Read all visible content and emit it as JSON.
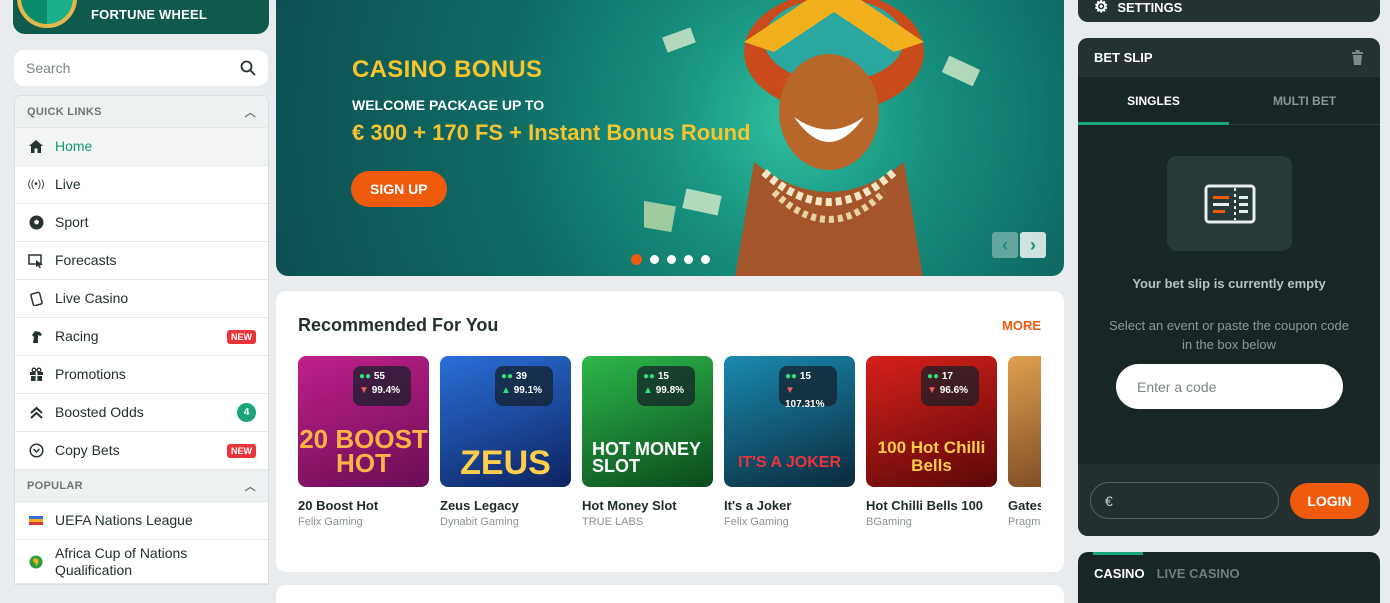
{
  "fortune": {
    "label": "FORTUNE WHEEL"
  },
  "search": {
    "placeholder": "Search"
  },
  "quick_links": {
    "header": "QUICK LINKS",
    "items": [
      {
        "label": "Home",
        "icon": "home-icon"
      },
      {
        "label": "Live",
        "icon": "live-icon"
      },
      {
        "label": "Sport",
        "icon": "soccer-ball-icon"
      },
      {
        "label": "Forecasts",
        "icon": "forecast-icon"
      },
      {
        "label": "Live Casino",
        "icon": "cards-icon"
      },
      {
        "label": "Racing",
        "icon": "horse-icon",
        "badge": "NEW"
      },
      {
        "label": "Promotions",
        "icon": "gift-icon"
      },
      {
        "label": "Boosted Odds",
        "icon": "boost-icon",
        "count": "4"
      },
      {
        "label": "Copy Bets",
        "icon": "copy-bets-icon",
        "badge": "NEW"
      }
    ]
  },
  "popular": {
    "header": "POPULAR",
    "items": [
      {
        "label": "UEFA Nations League"
      },
      {
        "label": "Africa Cup of Nations Qualification"
      }
    ]
  },
  "banner": {
    "title": "CASINO BONUS",
    "subtitle": "WELCOME PACKAGE UP TO",
    "offer": "€ 300 + 170 FS + Instant Bonus Round",
    "cta": "SIGN UP",
    "active_slide": 1,
    "slides": 5
  },
  "recommended": {
    "title": "Recommended For You",
    "more": "MORE",
    "games": [
      {
        "name": "20 Boost Hot",
        "provider": "Felix Gaming",
        "players": "55",
        "rtp": "99.4%",
        "art": "20 BOOST HOT",
        "bg": "#8a1a6a"
      },
      {
        "name": "Zeus Legacy",
        "provider": "Dynabit Gaming",
        "players": "39",
        "rtp": "99.1%",
        "art": "ZEUS",
        "bg": "#1a3f8a"
      },
      {
        "name": "Hot Money Slot",
        "provider": "TRUE LABS",
        "players": "15",
        "rtp": "99.8%",
        "art": "HOT MONEY SLOT",
        "bg": "#1a7a2e"
      },
      {
        "name": "It's a Joker",
        "provider": "Felix Gaming",
        "players": "15",
        "rtp": "107.31%",
        "art": "IT'S A JOKER",
        "bg": "#0f4a6a"
      },
      {
        "name": "Hot Chilli Bells 100",
        "provider": "BGaming",
        "players": "17",
        "rtp": "96.6%",
        "art": "100 Hot Chilli Bells",
        "bg": "#a3151a"
      },
      {
        "name": "Gates of Olympus Super",
        "provider": "Pragmatic Play",
        "players": "",
        "rtp": "",
        "art": "",
        "bg": "#8a5a2a"
      }
    ]
  },
  "settings": {
    "label": "SETTINGS"
  },
  "betslip": {
    "title": "BET SLIP",
    "tabs": [
      "SINGLES",
      "MULTI BET"
    ],
    "empty_title": "Your bet slip is currently empty",
    "empty_sub": "Select an event or paste the coupon code in the box below",
    "code_placeholder": "Enter a code",
    "currency": "€",
    "login": "LOGIN"
  },
  "casino_box": {
    "tabs": [
      "CASINO",
      "LIVE CASINO"
    ]
  }
}
